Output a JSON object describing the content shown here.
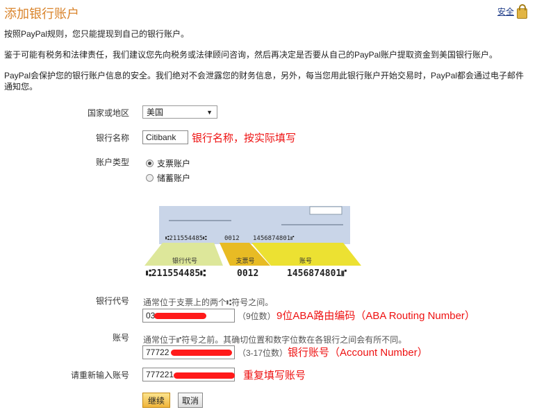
{
  "page": {
    "title": "添加银行账户",
    "security_link": "安全"
  },
  "intro": {
    "p1": "按照PayPal规则，您只能提现到自己的银行账户。",
    "p2": "鉴于可能有税务和法律责任，我们建议您先向税务或法律顾问咨询，然后再决定是否要从自己的PayPal账户提取资金到美国银行账户。",
    "p3": "PayPal会保护您的银行账户信息的安全。我们绝对不会泄露您的财务信息，另外，每当您用此银行账户开始交易时，PayPal都会通过电子邮件通知您。"
  },
  "form": {
    "country_label": "国家或地区",
    "country_value": "美国",
    "bank_name_label": "银行名称",
    "bank_name_value": "Citibank",
    "bank_name_note": "银行名称，按实际填写",
    "account_type_label": "账户类型",
    "account_types": [
      "支票账户",
      "储蓄账户"
    ],
    "account_type_selected": "支票账户",
    "routing_label": "银行代号",
    "routing_hint": "通常位于支票上的两个⑆符号之间。",
    "routing_value": "03",
    "routing_digits": "（9位数）",
    "routing_note": "9位ABA路由编码（ABA Routing Number）",
    "account_label": "账号",
    "account_hint": "通常位于⑈符号之前。其确切位置和数字位数在各银行之间会有所不同。",
    "account_value": "77722",
    "account_digits": "（3-17位数）",
    "account_note": "银行账号（Account Number）",
    "reenter_label": "请重新输入账号",
    "reenter_value": "777221",
    "reenter_note": "重复填写账号"
  },
  "check_image": {
    "micr_top_left": "⑆211554485⑆",
    "micr_top_mid": "0012",
    "micr_top_right": "1456874801⑈",
    "tab_routing": "银行代号",
    "tab_check": "支票号",
    "tab_account": "账号",
    "micr_bottom_left": "⑆211554485⑆",
    "micr_bottom_mid": "0012",
    "micr_bottom_right": "1456874801⑈"
  },
  "buttons": {
    "continue": "继续",
    "cancel": "取消"
  }
}
